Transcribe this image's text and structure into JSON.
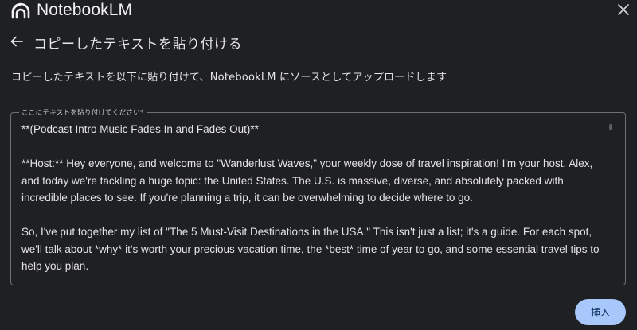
{
  "app": {
    "brand_name": "NotebookLM"
  },
  "dialog": {
    "title": "コピーしたテキストを貼り付ける",
    "description": "コピーしたテキストを以下に貼り付けて、NotebookLM にソースとしてアップロードします"
  },
  "field": {
    "label": "ここにテキストを貼り付けてください*",
    "value": "**(Podcast Intro Music Fades In and Fades Out)**\n\n**Host:** Hey everyone, and welcome to \"Wanderlust Waves,\" your weekly dose of travel inspiration! I'm your host, Alex, and today we're tackling a huge topic: the United States. The U.S. is massive, diverse, and absolutely packed with incredible places to see. If you're planning a trip, it can be overwhelming to decide where to go.\n\nSo, I've put together my list of \"The 5 Must-Visit Destinations in the USA.\" This isn't just a list; it's a guide. For each spot, we'll talk about *why* it's worth your precious vacation time, the *best* time of year to go, and some essential travel tips to help you plan."
  },
  "actions": {
    "insert_label": "挿入"
  },
  "icons": {
    "logo": "notebooklm-logo-icon",
    "close": "close-icon",
    "back": "arrow-back-icon"
  },
  "colors": {
    "background": "#1f2023",
    "primary_button": "#a8c7fa",
    "primary_button_text": "#0b2f5c",
    "border": "#6f7076"
  }
}
